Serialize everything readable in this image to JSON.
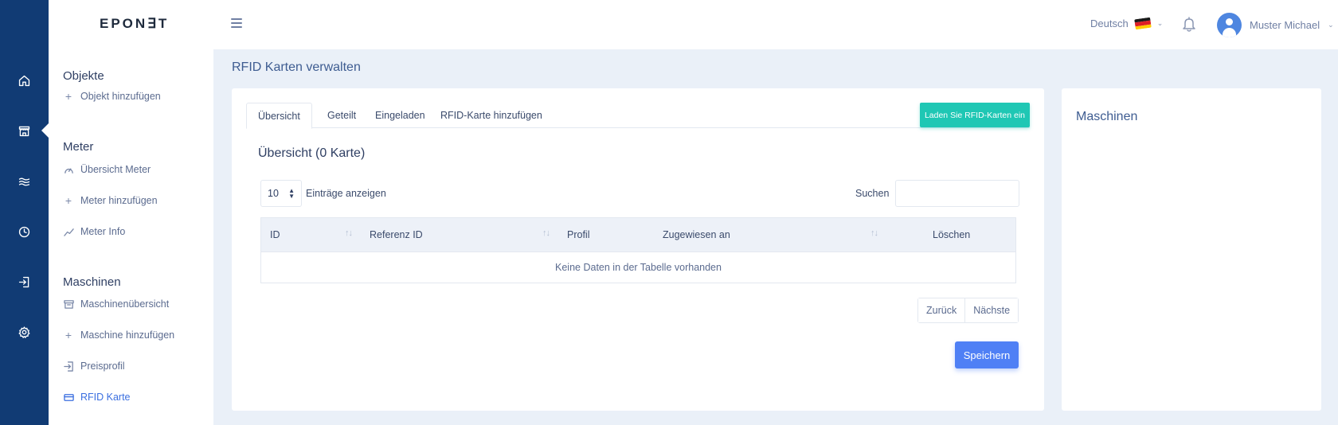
{
  "app": {
    "logo": "EPON∃T",
    "language": "Deutsch",
    "user_name": "Muster Michael"
  },
  "rail": {
    "icons": [
      "home-icon",
      "store-icon",
      "waves-icon",
      "clock-icon",
      "login-icon",
      "settings-icon"
    ]
  },
  "sidebar": {
    "sections": [
      {
        "title": "Objekte",
        "items": [
          {
            "label": "Objekt hinzufügen",
            "icon": "plus-icon"
          }
        ]
      },
      {
        "title": "Meter",
        "items": [
          {
            "label": "Übersicht Meter",
            "icon": "gauge-icon"
          },
          {
            "label": "Meter hinzufügen",
            "icon": "plus-icon"
          },
          {
            "label": "Meter Info",
            "icon": "chart-line-icon"
          }
        ]
      },
      {
        "title": "Maschinen",
        "items": [
          {
            "label": "Maschinenübersicht",
            "icon": "archive-icon"
          },
          {
            "label": "Maschine hinzufügen",
            "icon": "plus-icon"
          },
          {
            "label": "Preisprofil",
            "icon": "login-icon"
          },
          {
            "label": "RFID Karte",
            "icon": "card-icon",
            "active": true
          }
        ]
      }
    ]
  },
  "page": {
    "title": "RFID Karten verwalten"
  },
  "main": {
    "tabs": [
      {
        "label": "Übersicht",
        "active": true
      },
      {
        "label": "Geteilt"
      },
      {
        "label": "Eingeladen"
      },
      {
        "label": "RFID-Karte hinzufügen"
      }
    ],
    "load_button": "Laden Sie RFID-Karten ein",
    "overview_title": "Übersicht (0 Karte)",
    "page_length": {
      "value": "10",
      "label": "Einträge anzeigen"
    },
    "search": {
      "label": "Suchen",
      "value": "",
      "placeholder": ""
    },
    "table": {
      "columns": [
        "ID",
        "Referenz ID",
        "Profil",
        "Zugewiesen an",
        "Löschen"
      ],
      "empty_text": "Keine Daten in der Tabelle vorhanden"
    },
    "pager": {
      "prev": "Zurück",
      "next": "Nächste"
    },
    "save_button": "Speichern"
  },
  "right": {
    "title": "Maschinen"
  },
  "colors": {
    "rail": "#113b74",
    "accent_teal": "#1fc7b4",
    "accent_blue": "#4f80f5",
    "active_link": "#3b6fe0",
    "page_bg": "#eaf0f8"
  }
}
